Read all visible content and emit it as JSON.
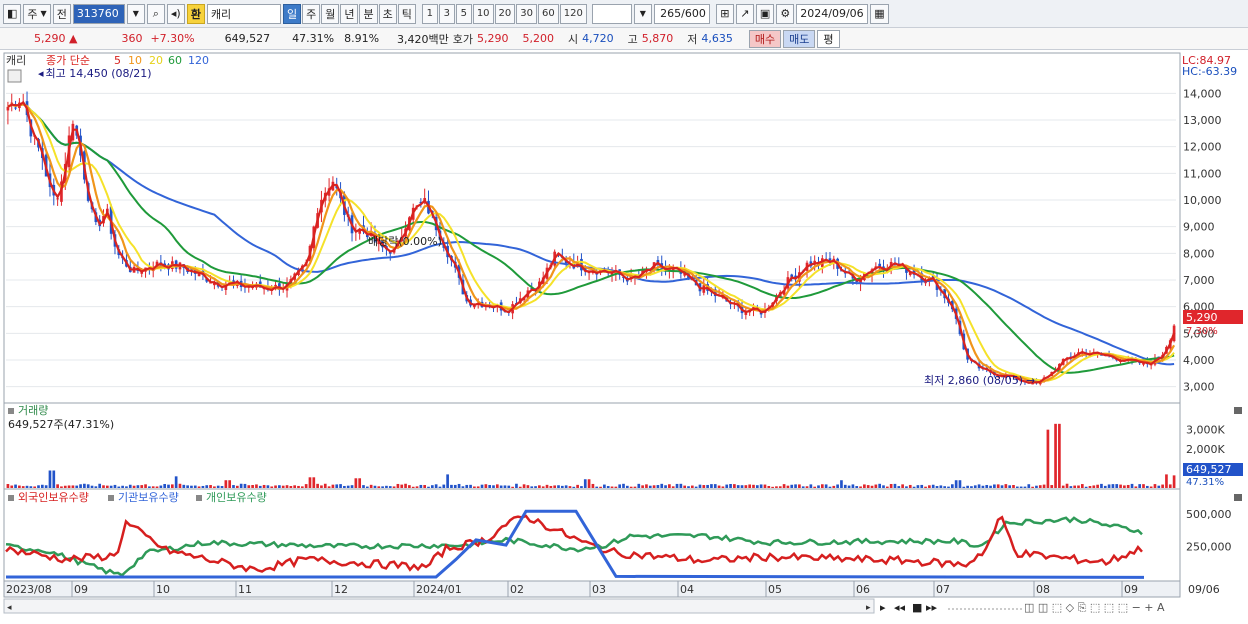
{
  "toolbar": {
    "period_primary": "주",
    "prev_label": "전",
    "stock_code": "313760",
    "stock_name_prefix": "환",
    "stock_name": "캐리",
    "periods": [
      "일",
      "주",
      "월",
      "년",
      "분",
      "초",
      "틱"
    ],
    "active_period": "일",
    "intervals": [
      "1",
      "3",
      "5",
      "10",
      "20",
      "30",
      "60",
      "120"
    ],
    "count_label": "265",
    "count_total": "/600",
    "date": "2024/09/06"
  },
  "quote": {
    "price": "5,290",
    "change": "360",
    "change_pct": "+7.30%",
    "volume": "649,527",
    "vol_ratio": "47.31%",
    "turnover": "8.91%",
    "amount": "3,420백만",
    "ask_label": "호가",
    "ask1": "5,290",
    "ask2": "5,200",
    "open_label": "시",
    "open": "4,720",
    "high_label": "고",
    "high": "5,870",
    "low_label": "저",
    "low": "4,635",
    "buy_label": "매수",
    "sell_label": "매도",
    "eval_label": "평"
  },
  "colors": {
    "candle_up": "#e0262c",
    "candle_down": "#2253c9",
    "ma5": "#d8231f",
    "ma10": "#f0951a",
    "ma20": "#f5e22a",
    "ma60": "#1f9a3a",
    "ma120": "#3264d8",
    "foreign": "#d61f1f",
    "institution": "#3264d8",
    "individual": "#2f9a58"
  },
  "chart_data": [
    {
      "type": "candlestick",
      "name": "캐리",
      "legend": {
        "series": "캐리",
        "ma_type": "종가 단순",
        "periods": [
          "5",
          "10",
          "20",
          "60",
          "120"
        ]
      },
      "x_ticks": [
        "2023/08",
        "09",
        "10",
        "11",
        "12",
        "2024/01",
        "02",
        "03",
        "04",
        "05",
        "06",
        "07",
        "08",
        "09",
        "09/06"
      ],
      "y_ticks": [
        "14,000",
        "13,000",
        "12,000",
        "11,000",
        "10,000",
        "9,000",
        "8,000",
        "7,000",
        "6,000",
        "5,000",
        "4,000",
        "3,000"
      ],
      "ylim": [
        2500,
        14800
      ],
      "lc": "LC:84.97",
      "hc": "HC:-63.39",
      "last_price": "5,290",
      "last_pct": "7.30%",
      "annotations": {
        "high": "최고 14,450 (08/21)",
        "low": "최저 2,860 (08/05)",
        "dividend": "배당락(0.00%)"
      },
      "keyframes": [
        [
          0,
          13500
        ],
        [
          12,
          13900
        ],
        [
          22,
          12300
        ],
        [
          30,
          11600
        ],
        [
          38,
          10000
        ],
        [
          45,
          10400
        ],
        [
          56,
          13100
        ],
        [
          64,
          11400
        ],
        [
          75,
          8900
        ],
        [
          85,
          9600
        ],
        [
          94,
          8000
        ],
        [
          108,
          7300
        ],
        [
          130,
          7600
        ],
        [
          150,
          7500
        ],
        [
          165,
          7200
        ],
        [
          180,
          6900
        ],
        [
          200,
          6800
        ],
        [
          225,
          6700
        ],
        [
          242,
          6800
        ],
        [
          258,
          7600
        ],
        [
          268,
          9900
        ],
        [
          280,
          10800
        ],
        [
          295,
          9000
        ],
        [
          310,
          8800
        ],
        [
          322,
          8200
        ],
        [
          335,
          8100
        ],
        [
          346,
          9500
        ],
        [
          360,
          9900
        ],
        [
          372,
          8800
        ],
        [
          383,
          7700
        ],
        [
          396,
          6200
        ],
        [
          412,
          6100
        ],
        [
          432,
          5900
        ],
        [
          448,
          6600
        ],
        [
          458,
          6800
        ],
        [
          472,
          7900
        ],
        [
          488,
          7600
        ],
        [
          505,
          7400
        ],
        [
          520,
          7300
        ],
        [
          540,
          7000
        ],
        [
          558,
          7500
        ],
        [
          578,
          7300
        ],
        [
          598,
          6700
        ],
        [
          612,
          6400
        ],
        [
          632,
          5900
        ],
        [
          652,
          5800
        ],
        [
          672,
          6900
        ],
        [
          690,
          7600
        ],
        [
          712,
          7700
        ],
        [
          730,
          7000
        ],
        [
          748,
          7500
        ],
        [
          765,
          7600
        ],
        [
          782,
          7300
        ],
        [
          800,
          6900
        ],
        [
          815,
          6000
        ],
        [
          828,
          4000
        ],
        [
          842,
          3600
        ],
        [
          862,
          3400
        ],
        [
          878,
          3200
        ],
        [
          888,
          3100
        ],
        [
          900,
          3500
        ],
        [
          912,
          4000
        ],
        [
          925,
          4300
        ],
        [
          950,
          4150
        ],
        [
          968,
          3950
        ],
        [
          983,
          3850
        ],
        [
          995,
          4100
        ],
        [
          1008,
          5290
        ]
      ]
    },
    {
      "type": "bar",
      "name": "거래량",
      "legend": "거래량",
      "current": "649,527주(47.31%)",
      "y_ticks": [
        "3,000K",
        "2,000K",
        "1,000K"
      ],
      "last_value": "649,527",
      "last_pct": "47.31%"
    },
    {
      "type": "line",
      "legend": [
        "외국인보유수량",
        "기관보유수량",
        "개인보유수량"
      ],
      "y_ticks": [
        "500,000",
        "250,000"
      ]
    }
  ]
}
